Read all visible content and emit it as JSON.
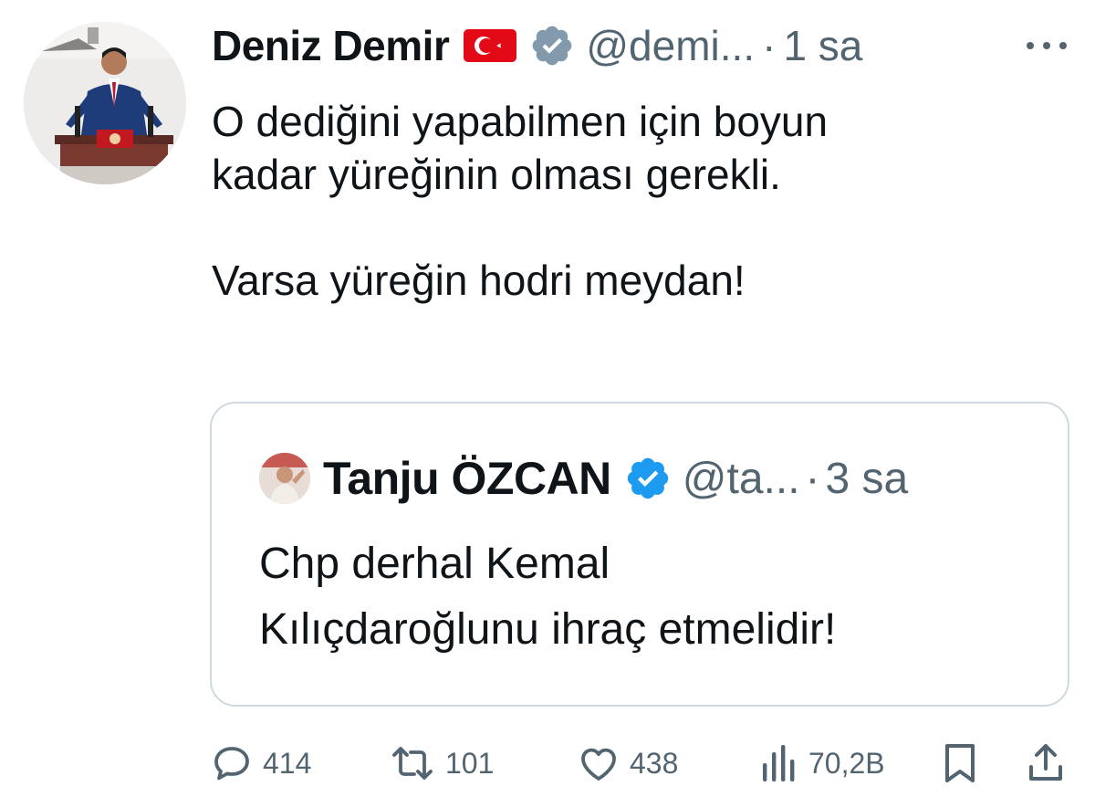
{
  "tweet": {
    "author_name": "Deniz Demir",
    "author_handle": "@demi...",
    "separator": "·",
    "time": "1 sa",
    "text": "O dediğini yapabilmen için boyun\nkadar yüreğinin olması gerekli.\n\nVarsa yüreğin hodri meydan!",
    "icons": {
      "flag": "turkey-flag-icon",
      "verified": "gray-verified-badge-icon",
      "more": "more-options-icon"
    }
  },
  "quoted_tweet": {
    "author_name": "Tanju ÖZCAN",
    "author_handle": "@ta...",
    "separator": "·",
    "time": "3 sa",
    "text": "Chp derhal Kemal\nKılıçdaroğlunu ihraç etmelidir!",
    "icons": {
      "verified": "blue-verified-badge-icon"
    }
  },
  "actions": {
    "replies": "414",
    "retweets": "101",
    "likes": "438",
    "views": "70,2B",
    "icons": [
      "reply-icon",
      "retweet-icon",
      "like-icon",
      "views-icon",
      "bookmark-icon",
      "share-icon"
    ]
  },
  "colors": {
    "text": "#0f1419",
    "secondary": "#536471",
    "border": "#cfd9de",
    "verified_gray": "#829aab",
    "verified_blue": "#1d9bf0",
    "flag_red": "#e30a17"
  }
}
